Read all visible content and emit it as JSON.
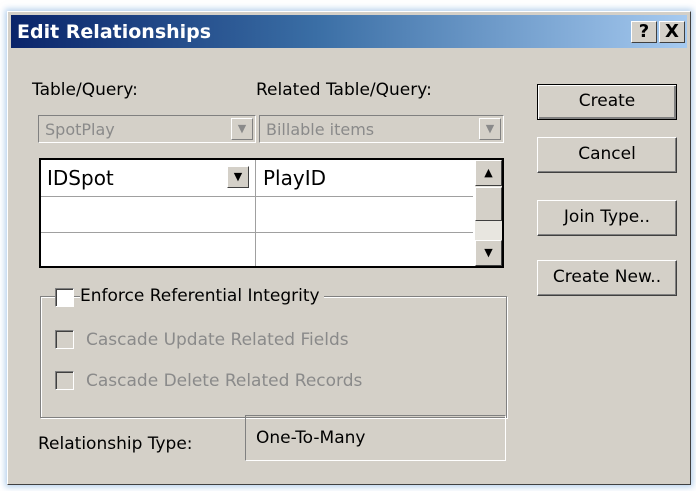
{
  "window": {
    "title": "Edit Relationships",
    "help_label": "?",
    "close_label": "X"
  },
  "left": {
    "table_label": "Table/Query:",
    "related_label": "Related Table/Query:",
    "table_value": "SpotPlay",
    "related_value": "Billable items"
  },
  "grid": {
    "rows": [
      {
        "left": "IDSpot",
        "right": "PlayID"
      },
      {
        "left": "",
        "right": ""
      },
      {
        "left": "",
        "right": ""
      }
    ]
  },
  "options": {
    "enforce_label": "Enforce Referential Integrity",
    "enforce_checked": false,
    "cascade_update_label": "Cascade Update Related Fields",
    "cascade_update_checked": false,
    "cascade_delete_label": "Cascade Delete Related Records",
    "cascade_delete_checked": false
  },
  "relationship": {
    "label": "Relationship Type:",
    "value": "One-To-Many"
  },
  "buttons": {
    "create": "Create",
    "cancel": "Cancel",
    "join_type": "Join Type..",
    "create_new": "Create New.."
  },
  "icons": {
    "dropdown": "chevron-down-icon",
    "scroll_up": "arrow-up-icon",
    "scroll_down": "arrow-down-icon",
    "help": "help-icon",
    "close": "close-icon"
  }
}
